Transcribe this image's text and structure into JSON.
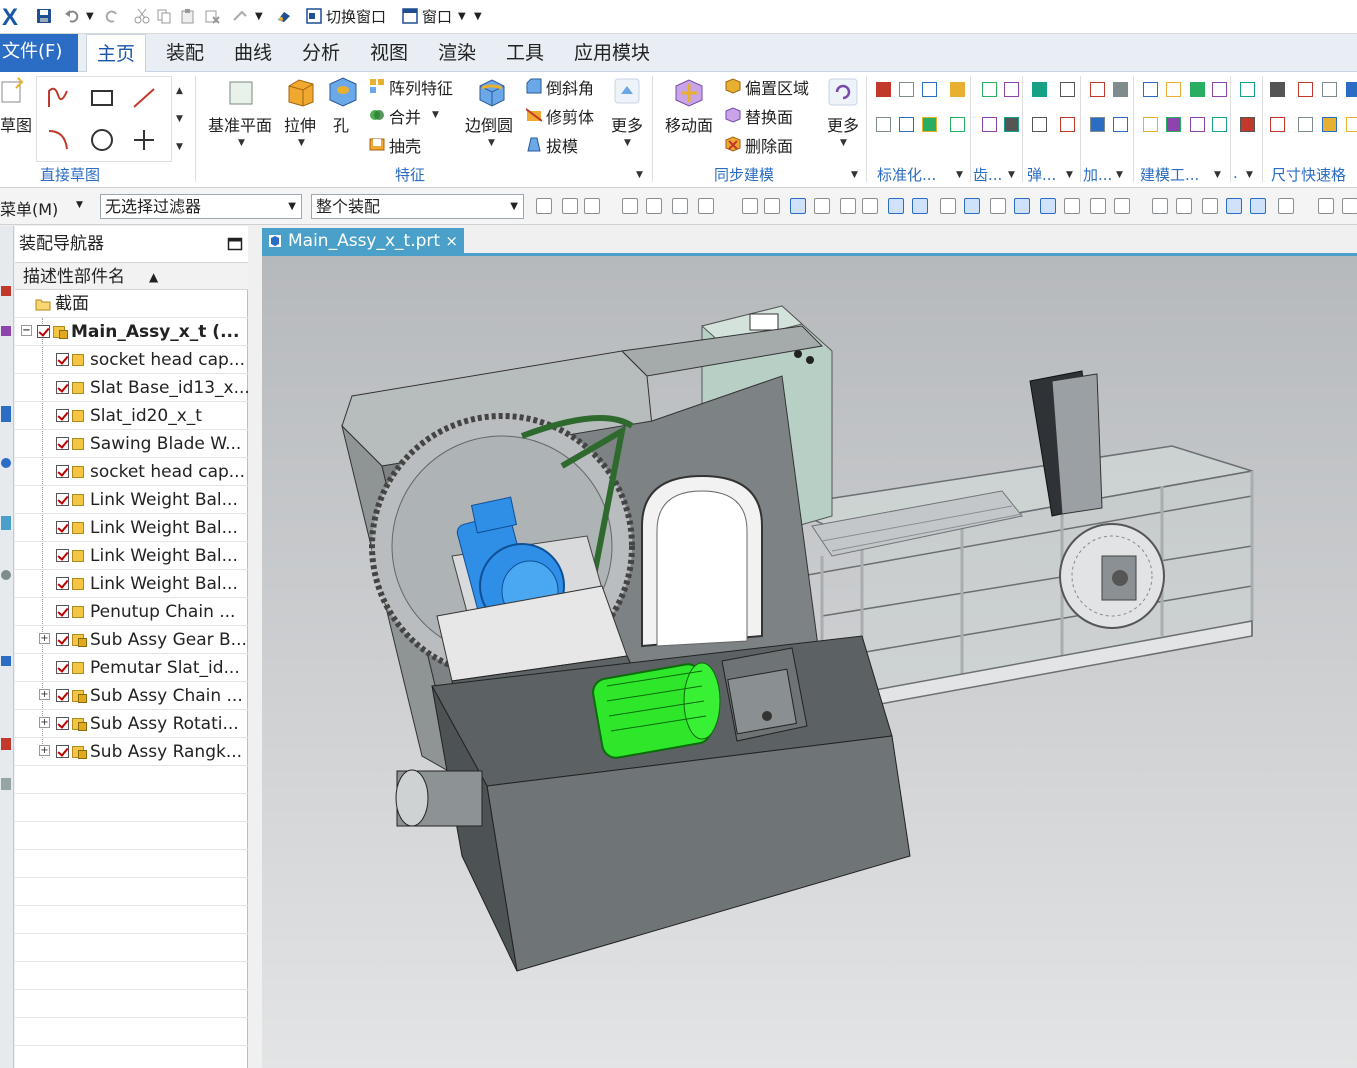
{
  "app": {
    "logo": "X"
  },
  "quick_access": {
    "switch_window": "切换窗口",
    "window": "窗口"
  },
  "menu": {
    "file": "文件(F)",
    "tabs": [
      "主页",
      "装配",
      "曲线",
      "分析",
      "视图",
      "渲染",
      "工具",
      "应用模块"
    ],
    "active_tab": "主页"
  },
  "ribbon": {
    "sketch_partial": "草图",
    "direct_sketch_label": "直接草图",
    "feature": {
      "datum_plane": "基准平面",
      "extrude": "拉伸",
      "hole": "孔",
      "pattern_feature": "阵列特征",
      "unite": "合并",
      "shell": "抽壳",
      "edge_blend": "边倒圆",
      "chamfer": "倒斜角",
      "trim_body": "修剪体",
      "draft": "拔模",
      "more": "更多",
      "label": "特征"
    },
    "sync": {
      "move_face": "移动面",
      "offset_region": "偏置区域",
      "replace_face": "替换面",
      "delete_face": "删除面",
      "more": "更多",
      "label": "同步建模"
    },
    "small_groups": [
      "标准化...",
      "齿...",
      "弹...",
      "加...",
      "建模工...",
      ".",
      "尺寸快速格"
    ]
  },
  "selection_bar": {
    "menu": "菜单(M)",
    "filter": "无选择过滤器",
    "scope": "整个装配"
  },
  "navigator": {
    "title": "装配导航器",
    "column_header": "描述性部件名",
    "sections_folder": "截面",
    "root": "Main_Assy_x_t  (...",
    "items": [
      {
        "label": "socket head cap...",
        "type": "part"
      },
      {
        "label": "Slat Base_id13_x...",
        "type": "part"
      },
      {
        "label": "Slat_id20_x_t",
        "type": "part"
      },
      {
        "label": "Sawing Blade W...",
        "type": "part"
      },
      {
        "label": "socket head cap...",
        "type": "part"
      },
      {
        "label": "Link Weight Bal...",
        "type": "part"
      },
      {
        "label": "Link Weight Bal...",
        "type": "part"
      },
      {
        "label": "Link Weight Bal...",
        "type": "part"
      },
      {
        "label": "Link Weight Bal...",
        "type": "part"
      },
      {
        "label": "Penutup Chain ...",
        "type": "part"
      },
      {
        "label": "Sub Assy Gear B...",
        "type": "assembly"
      },
      {
        "label": "Pemutar Slat_id...",
        "type": "part"
      },
      {
        "label": "Sub Assy Chain ...",
        "type": "assembly"
      },
      {
        "label": "Sub Assy Rotati...",
        "type": "assembly"
      },
      {
        "label": "Sub Assy Rangk...",
        "type": "assembly"
      }
    ]
  },
  "document": {
    "tab_title": "Main_Assy_x_t.prt",
    "close": "×"
  },
  "colors": {
    "accent": "#2b6cc4",
    "doc_tab": "#4aa0c9",
    "motor_blue": "#2f8ee6",
    "motor_green": "#2ee62a"
  }
}
